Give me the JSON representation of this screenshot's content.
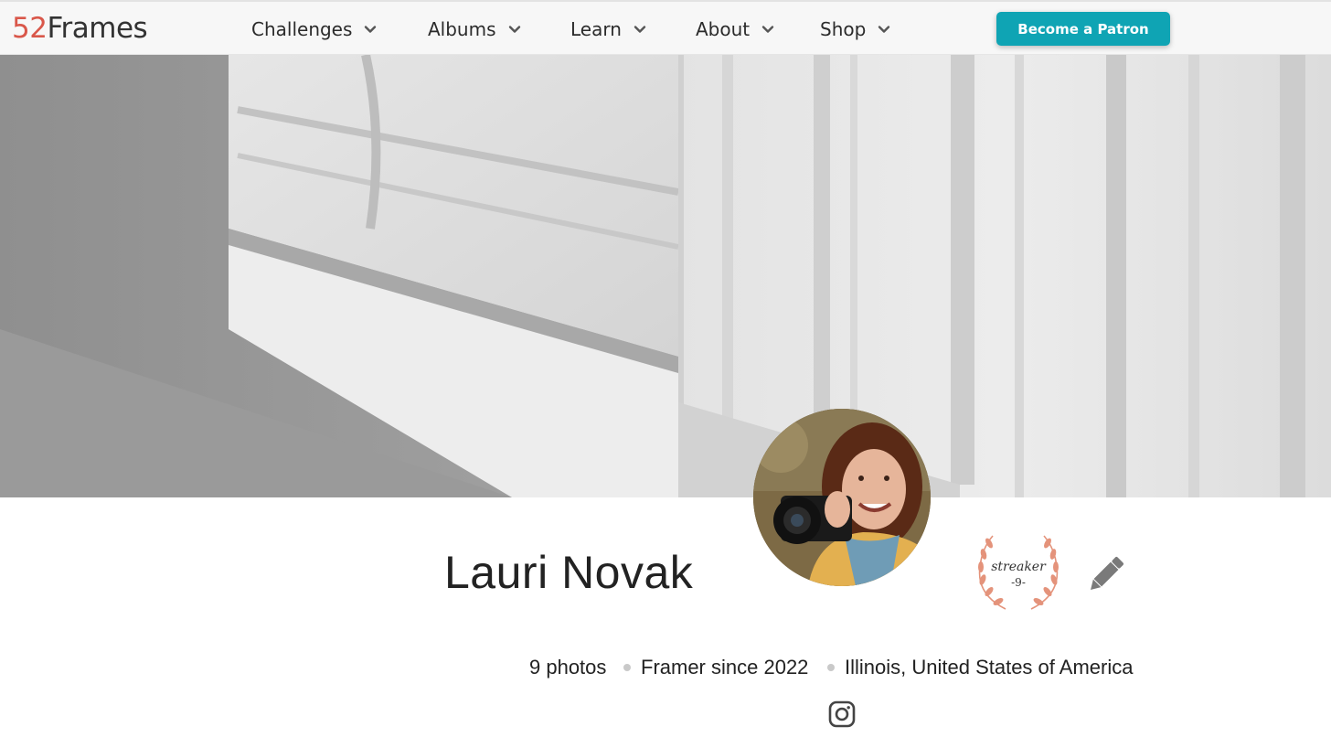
{
  "header": {
    "logo_number": "52",
    "logo_word": "Frames",
    "nav": [
      {
        "label": "Challenges"
      },
      {
        "label": "Albums"
      },
      {
        "label": "Learn"
      },
      {
        "label": "About"
      },
      {
        "label": "Shop"
      }
    ],
    "cta_label": "Become a Patron"
  },
  "profile": {
    "name": "Lauri Novak",
    "badge": {
      "line1": "streaker",
      "line2": "-9-"
    },
    "stats": {
      "photos": "9 photos",
      "since": "Framer since 2022",
      "location": "Illinois, United States of America"
    }
  },
  "icons": {
    "nav_dropdown": "chevron-down-icon",
    "edit": "pencil-icon",
    "social": "instagram-icon",
    "badge": "laurel-wreath-icon"
  },
  "colors": {
    "logo_number": "#d9574a",
    "cta_background": "#0fa4b4",
    "badge_laurel": "#e4937b"
  }
}
